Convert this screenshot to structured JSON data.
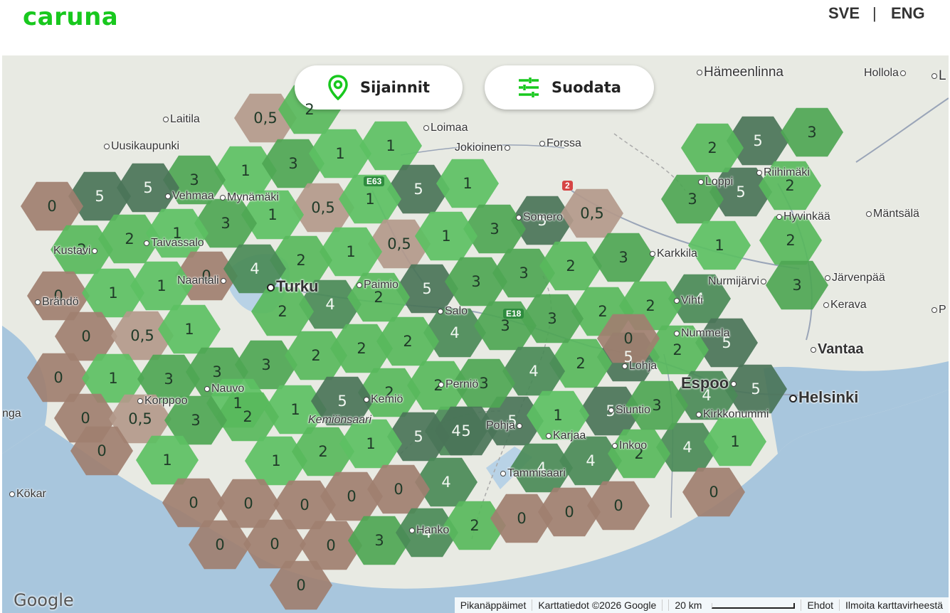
{
  "header": {
    "logo": "caruna",
    "lang_sv": "SVE",
    "separator": "|",
    "lang_en": "ENG"
  },
  "controls": {
    "locations_label": "Sijainnit",
    "filter_label": "Suodata",
    "locations_icon": "map-pin-icon",
    "filter_icon": "sliders-icon"
  },
  "places": {
    "hameenlinna": "Hämeenlinna",
    "hollola": "Hollola",
    "lahti_partial": "L",
    "laitila": "Laitila",
    "loimaa": "Loimaa",
    "uusikaupunki": "Uusikaupunki",
    "jokioinen": "Jokioinen",
    "forssa": "Forssa",
    "riihimaki": "Riihimäki",
    "loppi": "Loppi",
    "vehmaa": "Vehmaa",
    "mynamaki": "Mynämäki",
    "somero": "Somero",
    "hyvinkaa": "Hyvinkää",
    "mantsala": "Mäntsälä",
    "kustavi": "Kustavi",
    "taivassalo": "Taivassalo",
    "karkkila": "Karkkila",
    "naantali": "Naantali",
    "turku": "Turku",
    "paimio": "Paimio",
    "nurmijarvi": "Nurmijärvi",
    "jarvenpaa": "Järvenpää",
    "brando": "Brändö",
    "vihti": "Vihti",
    "kerava": "Kerava",
    "p_partial": "P",
    "salo": "Salo",
    "nummela": "Nummela",
    "vantaa": "Vantaa",
    "lohja": "Lohja",
    "espoo": "Espoo",
    "helsinki": "Helsinki",
    "nauvo": "Nauvo",
    "pernio": "Perniö",
    "korppoo": "Korppoo",
    "kemio": "Kemiö",
    "siuntio": "Siuntio",
    "kirkkonummi": "Kirkkonummi",
    "inga_partial": "nga",
    "kemionsaari": "Kemiönsaari",
    "pohja": "Pohja",
    "karjaa": "Karjaa",
    "inkoo": "Inkoo",
    "kokar": "Kökar",
    "tammisaari": "Tammisaari",
    "hanko": "Hanko"
  },
  "road_signs": {
    "e63": "E63",
    "e18": "E18",
    "r2": "2"
  },
  "hex_values": [
    {
      "v": "0,5",
      "dark": false
    },
    {
      "v": "2",
      "dark": false
    },
    {
      "v": "1",
      "dark": false
    },
    {
      "v": "3",
      "dark": false
    },
    {
      "v": "1",
      "dark": false
    },
    {
      "v": "3",
      "dark": false
    },
    {
      "v": "5",
      "dark": true
    },
    {
      "v": "5",
      "dark": true
    },
    {
      "v": "1",
      "dark": false
    },
    {
      "v": "5",
      "dark": true
    },
    {
      "v": "0",
      "dark": false
    },
    {
      "v": "5",
      "dark": true
    },
    {
      "v": "1",
      "dark": false
    },
    {
      "v": "0,5",
      "dark": false
    },
    {
      "v": "1",
      "dark": false
    },
    {
      "v": "5",
      "dark": true
    },
    {
      "v": "0,5",
      "dark": false
    },
    {
      "v": "1",
      "dark": false
    },
    {
      "v": "3",
      "dark": false
    },
    {
      "v": "3",
      "dark": false
    },
    {
      "v": "5",
      "dark": true
    },
    {
      "v": "2",
      "dark": false
    },
    {
      "v": "2",
      "dark": false
    },
    {
      "v": "0,5",
      "dark": false
    },
    {
      "v": "1",
      "dark": false
    },
    {
      "v": "3",
      "dark": false
    },
    {
      "v": "2",
      "dark": false
    },
    {
      "v": "2",
      "dark": false
    },
    {
      "v": "1",
      "dark": false
    },
    {
      "v": "1",
      "dark": false
    },
    {
      "v": "5",
      "dark": true
    },
    {
      "v": "3",
      "dark": false
    },
    {
      "v": "3",
      "dark": false
    },
    {
      "v": "2",
      "dark": false
    },
    {
      "v": "0",
      "dark": false
    },
    {
      "v": "4",
      "dark": true
    },
    {
      "v": "2",
      "dark": false
    },
    {
      "v": "2",
      "dark": false
    },
    {
      "v": "3",
      "dark": false
    },
    {
      "v": "1",
      "dark": false
    },
    {
      "v": "0",
      "dark": false
    },
    {
      "v": "1",
      "dark": false
    },
    {
      "v": "1",
      "dark": false
    },
    {
      "v": "4",
      "dark": true
    },
    {
      "v": "2",
      "dark": false
    },
    {
      "v": "4",
      "dark": true
    },
    {
      "v": "3",
      "dark": false
    },
    {
      "v": "3",
      "dark": false
    },
    {
      "v": "2",
      "dark": false
    },
    {
      "v": "2",
      "dark": false
    },
    {
      "v": "4",
      "dark": true
    },
    {
      "v": "0",
      "dark": false
    },
    {
      "v": "0,5",
      "dark": false
    },
    {
      "v": "1",
      "dark": false
    },
    {
      "v": "2",
      "dark": false
    },
    {
      "v": "2",
      "dark": false
    },
    {
      "v": "3",
      "dark": false
    },
    {
      "v": "5",
      "dark": true
    },
    {
      "v": "0",
      "dark": false
    },
    {
      "v": "1",
      "dark": false
    },
    {
      "v": "3",
      "dark": false
    },
    {
      "v": "3",
      "dark": false
    },
    {
      "v": "3",
      "dark": false
    },
    {
      "v": "2",
      "dark": false
    },
    {
      "v": "2",
      "dark": false
    },
    {
      "v": "2",
      "dark": false
    },
    {
      "v": "4",
      "dark": true
    },
    {
      "v": "3",
      "dark": false
    },
    {
      "v": "2",
      "dark": false
    },
    {
      "v": "4",
      "dark": true
    },
    {
      "v": "5",
      "dark": true
    },
    {
      "v": "5",
      "dark": true
    },
    {
      "v": "1",
      "dark": false
    },
    {
      "v": "0",
      "dark": false
    },
    {
      "v": "0,5",
      "dark": false
    },
    {
      "v": "3",
      "dark": false
    },
    {
      "v": "2",
      "dark": false
    },
    {
      "v": "1",
      "dark": false
    },
    {
      "v": "5",
      "dark": true
    },
    {
      "v": "2",
      "dark": false
    },
    {
      "v": "2",
      "dark": false
    },
    {
      "v": "5",
      "dark": true
    },
    {
      "v": "5",
      "dark": true
    },
    {
      "v": "5",
      "dark": true
    },
    {
      "v": "3",
      "dark": false
    },
    {
      "v": "4",
      "dark": true
    },
    {
      "v": "1",
      "dark": false
    },
    {
      "v": "1",
      "dark": false
    },
    {
      "v": "1",
      "dark": false
    },
    {
      "v": "2",
      "dark": false
    },
    {
      "v": "1",
      "dark": false
    },
    {
      "v": "5",
      "dark": true
    },
    {
      "v": "4",
      "dark": true
    },
    {
      "v": "4",
      "dark": true
    },
    {
      "v": "2",
      "dark": false
    },
    {
      "v": "4",
      "dark": true
    },
    {
      "v": "1",
      "dark": false
    },
    {
      "v": "0",
      "dark": false
    },
    {
      "v": "0",
      "dark": false
    },
    {
      "v": "0",
      "dark": false
    },
    {
      "v": "0",
      "dark": false
    },
    {
      "v": "0",
      "dark": false
    },
    {
      "v": "4",
      "dark": true
    },
    {
      "v": "3",
      "dark": false
    },
    {
      "v": "0",
      "dark": false
    },
    {
      "v": "0",
      "dark": false
    },
    {
      "v": "0",
      "dark": false
    },
    {
      "v": "0",
      "dark": false
    },
    {
      "v": "0",
      "dark": false
    },
    {
      "v": "0",
      "dark": false
    },
    {
      "v": "3",
      "dark": false
    },
    {
      "v": "4",
      "dark": true
    },
    {
      "v": "2",
      "dark": false
    },
    {
      "v": "0",
      "dark": false
    },
    {
      "v": "0",
      "dark": false
    },
    {
      "v": "0",
      "dark": false
    },
    {
      "v": "0",
      "dark": false
    }
  ],
  "footer": {
    "google": "Google",
    "shortcuts": "Pikanäppäimet",
    "mapdata": "Karttatiedot ©2026 Google",
    "scale": "20 km",
    "terms": "Ehdot",
    "report": "Ilmoita karttavirheestä"
  },
  "colors": {
    "brand": "#18c81e",
    "hex_0": "#a07f70",
    "hex_05": "#b3998b",
    "hex_1": "#5cc063",
    "hex_2": "#58b85c",
    "hex_3": "#4ea654",
    "hex_4": "#4a8a57",
    "hex_5": "#4a7458",
    "water": "#a8c6dd",
    "land": "#e8eae3"
  }
}
